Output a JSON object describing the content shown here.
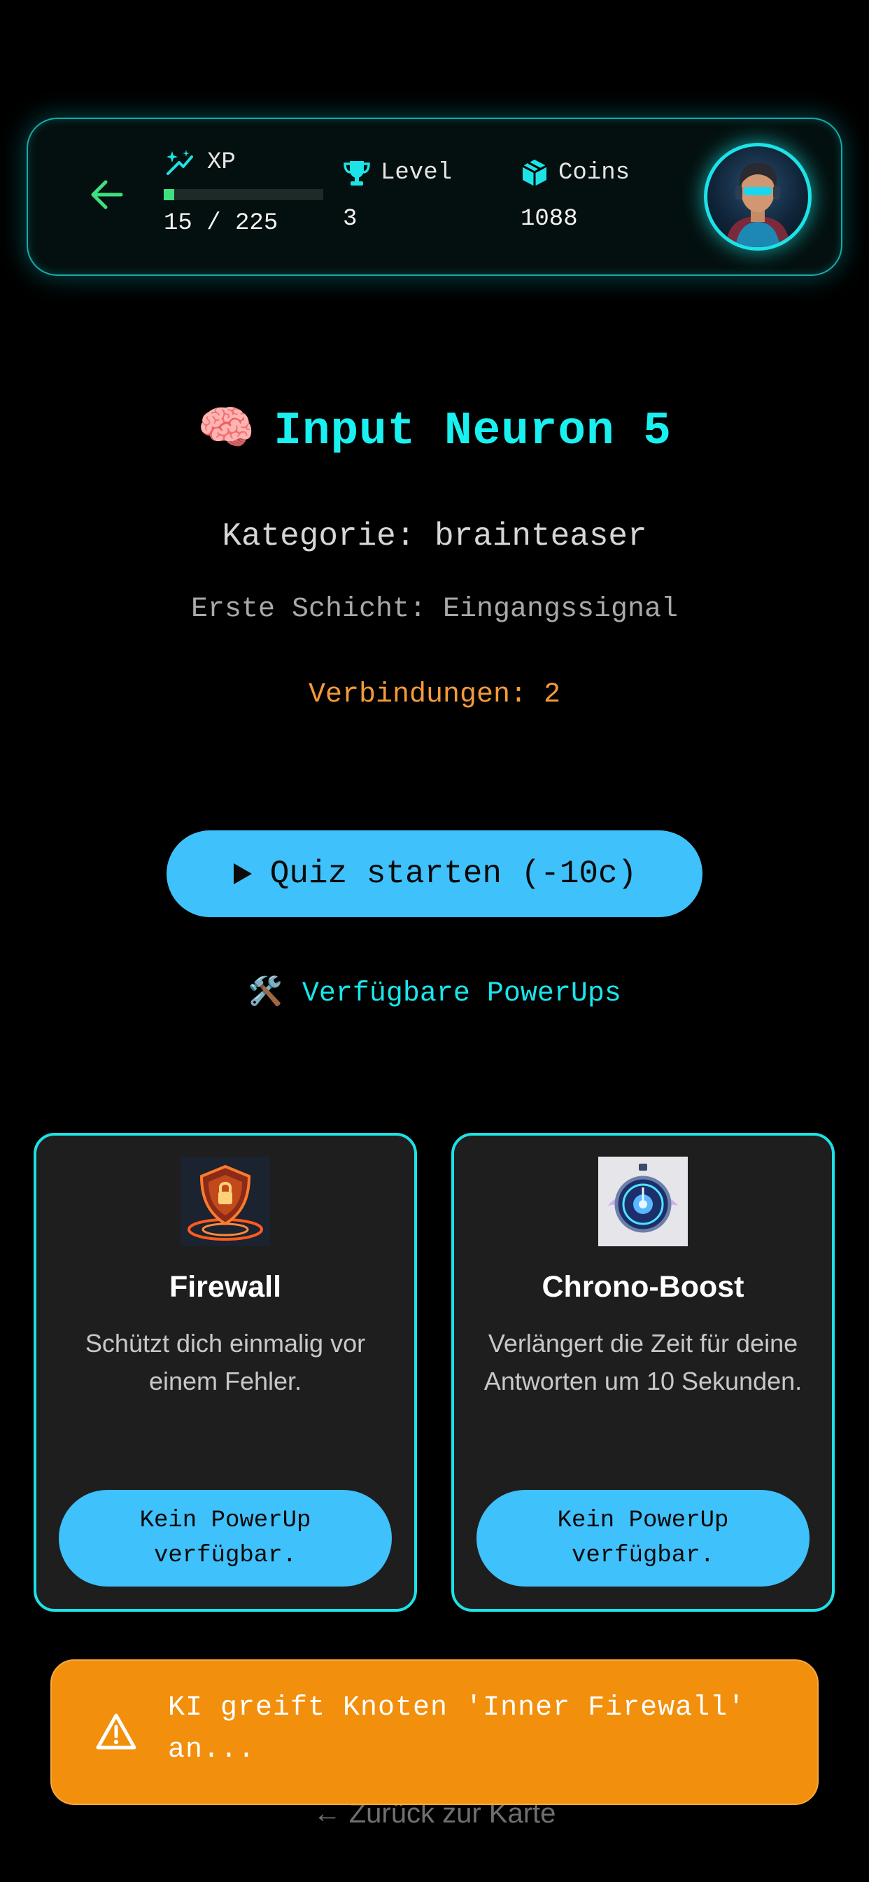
{
  "header": {
    "xp_label": "XP",
    "xp_value": "15 / 225",
    "xp_progress": 0.0667,
    "level_label": "Level",
    "level_value": "3",
    "coins_label": "Coins",
    "coins_value": "1088",
    "accent_color": "#1de2e6"
  },
  "node": {
    "emoji": "🧠",
    "title": "Input Neuron 5",
    "category": "Kategorie: brainteaser",
    "layer": "Erste Schicht: Eingangssignal",
    "connections": "Verbindungen: 2"
  },
  "quiz_button": {
    "label": "Quiz starten (-10c)",
    "color": "#3fc1fb"
  },
  "powerups": {
    "title": "Verfügbare PowerUps",
    "icon": "🛠️",
    "cards": [
      {
        "name": "Firewall",
        "description": "Schützt dich einmalig vor einem Fehler.",
        "button_label": "Kein PowerUp\nverfügbar.",
        "icon": "shield-lock-icon"
      },
      {
        "name": "Chrono-Boost",
        "description": "Verlängert die Zeit für deine Antworten um 10 Sekunden.",
        "button_label": "Kein PowerUp\nverfügbar.",
        "icon": "stopwatch-icon"
      }
    ]
  },
  "toast": {
    "message": "KI greift Knoten 'Inner Firewall' an...",
    "color": "#f28f0c",
    "icon": "warning-icon"
  },
  "footer": {
    "back_link": "← Zurück zur Karte"
  }
}
